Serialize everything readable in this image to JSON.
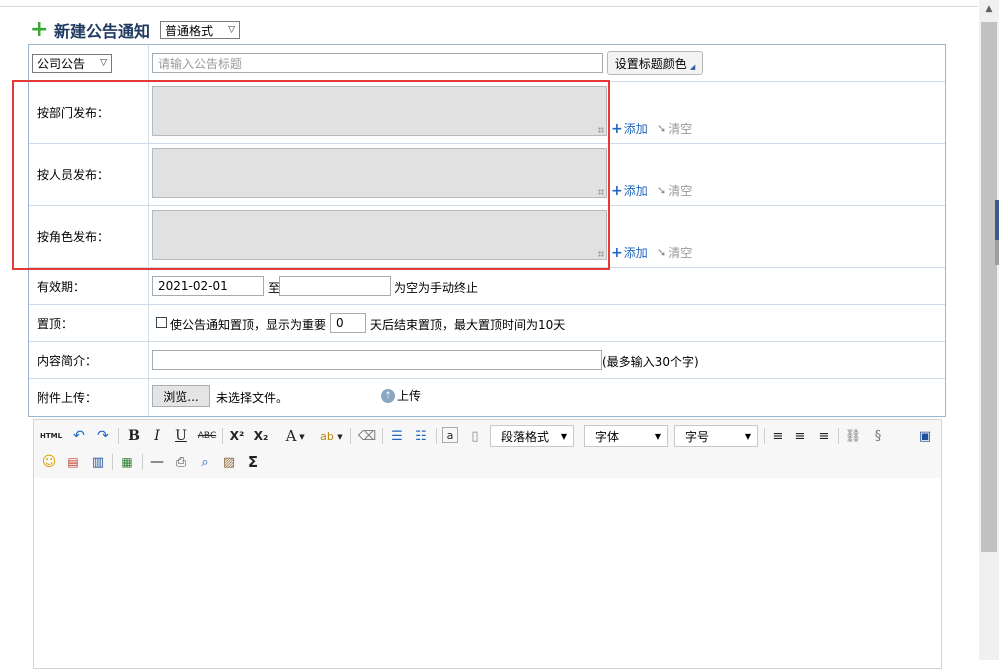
{
  "header": {
    "title": "新建公告通知",
    "format_select": "普通格式"
  },
  "form": {
    "category_select": "公司公告",
    "title_placeholder": "请输入公告标题",
    "set_title_color_button": "设置标题颜色",
    "rows": {
      "dept_label": "按部门发布：",
      "person_label": "按人员发布：",
      "role_label": "按角色发布：",
      "add_label": "添加",
      "clear_label": "清空"
    },
    "validity": {
      "label": "有效期：",
      "start_date": "2021-02-01",
      "to_text": "至",
      "end_date": "",
      "hint": "为空为手动终止"
    },
    "pin": {
      "label": "置顶：",
      "checkbox_text": "使公告通知置顶，显示为重要",
      "days": "0",
      "suffix": "天后结束置顶，最大置顶时间为10天"
    },
    "summary": {
      "label": "内容简介：",
      "value": "",
      "hint": "(最多输入30个字)"
    },
    "attachment": {
      "label": "附件上传：",
      "browse_button": "浏览...",
      "file_status": "未选择文件。",
      "upload_button": "上传"
    }
  },
  "editor": {
    "combos": {
      "paragraph": "段落格式",
      "font": "字体",
      "size": "字号"
    },
    "icons": [
      "html-icon",
      "undo-icon",
      "redo-icon",
      "bold-icon",
      "italic-icon",
      "underline-icon",
      "strikethrough-icon",
      "superscript-icon",
      "subscript-icon",
      "font-color-icon",
      "highlight-color-icon",
      "eraser-icon",
      "ordered-list-icon",
      "unordered-list-icon",
      "anchor-icon",
      "document-icon",
      "align-left-icon",
      "align-center-icon",
      "align-right-icon",
      "link-icon",
      "unlink-icon",
      "preview-icon",
      "emoticon-icon",
      "image-icon",
      "video-icon",
      "image-gallery-icon",
      "horizontal-rule-icon",
      "print-icon",
      "search-replace-icon",
      "paste-icon",
      "formula-icon"
    ]
  },
  "colors": {
    "title": "#1f3a60",
    "accent_blue": "#1f66c2",
    "highlight_box": "#e53935"
  }
}
